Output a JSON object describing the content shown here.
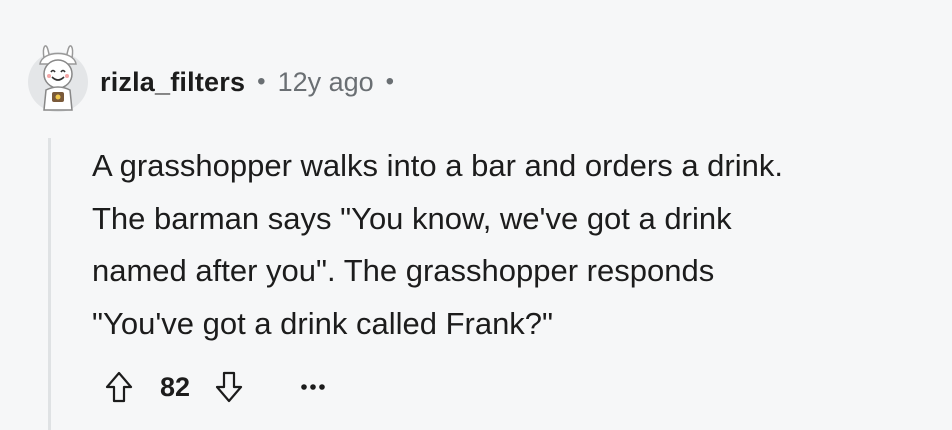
{
  "comment": {
    "username": "rizla_filters",
    "timestamp": "12y ago",
    "separator": "•",
    "body_lines": [
      "A grasshopper walks into a bar and orders a drink.",
      "The barman says \"You know, we've got a drink",
      "named after you\". The grasshopper responds",
      "\"You've got a drink called Frank?\""
    ],
    "score": "82"
  },
  "icons": {
    "avatar": "avatar-icon",
    "upvote": "upvote-arrow-icon",
    "downvote": "downvote-arrow-icon",
    "more": "more-options-icon"
  },
  "colors": {
    "background": "#f6f7f8",
    "text": "#1c1c1c",
    "muted": "#6a6f73",
    "thread_line": "#dfe2e4"
  }
}
